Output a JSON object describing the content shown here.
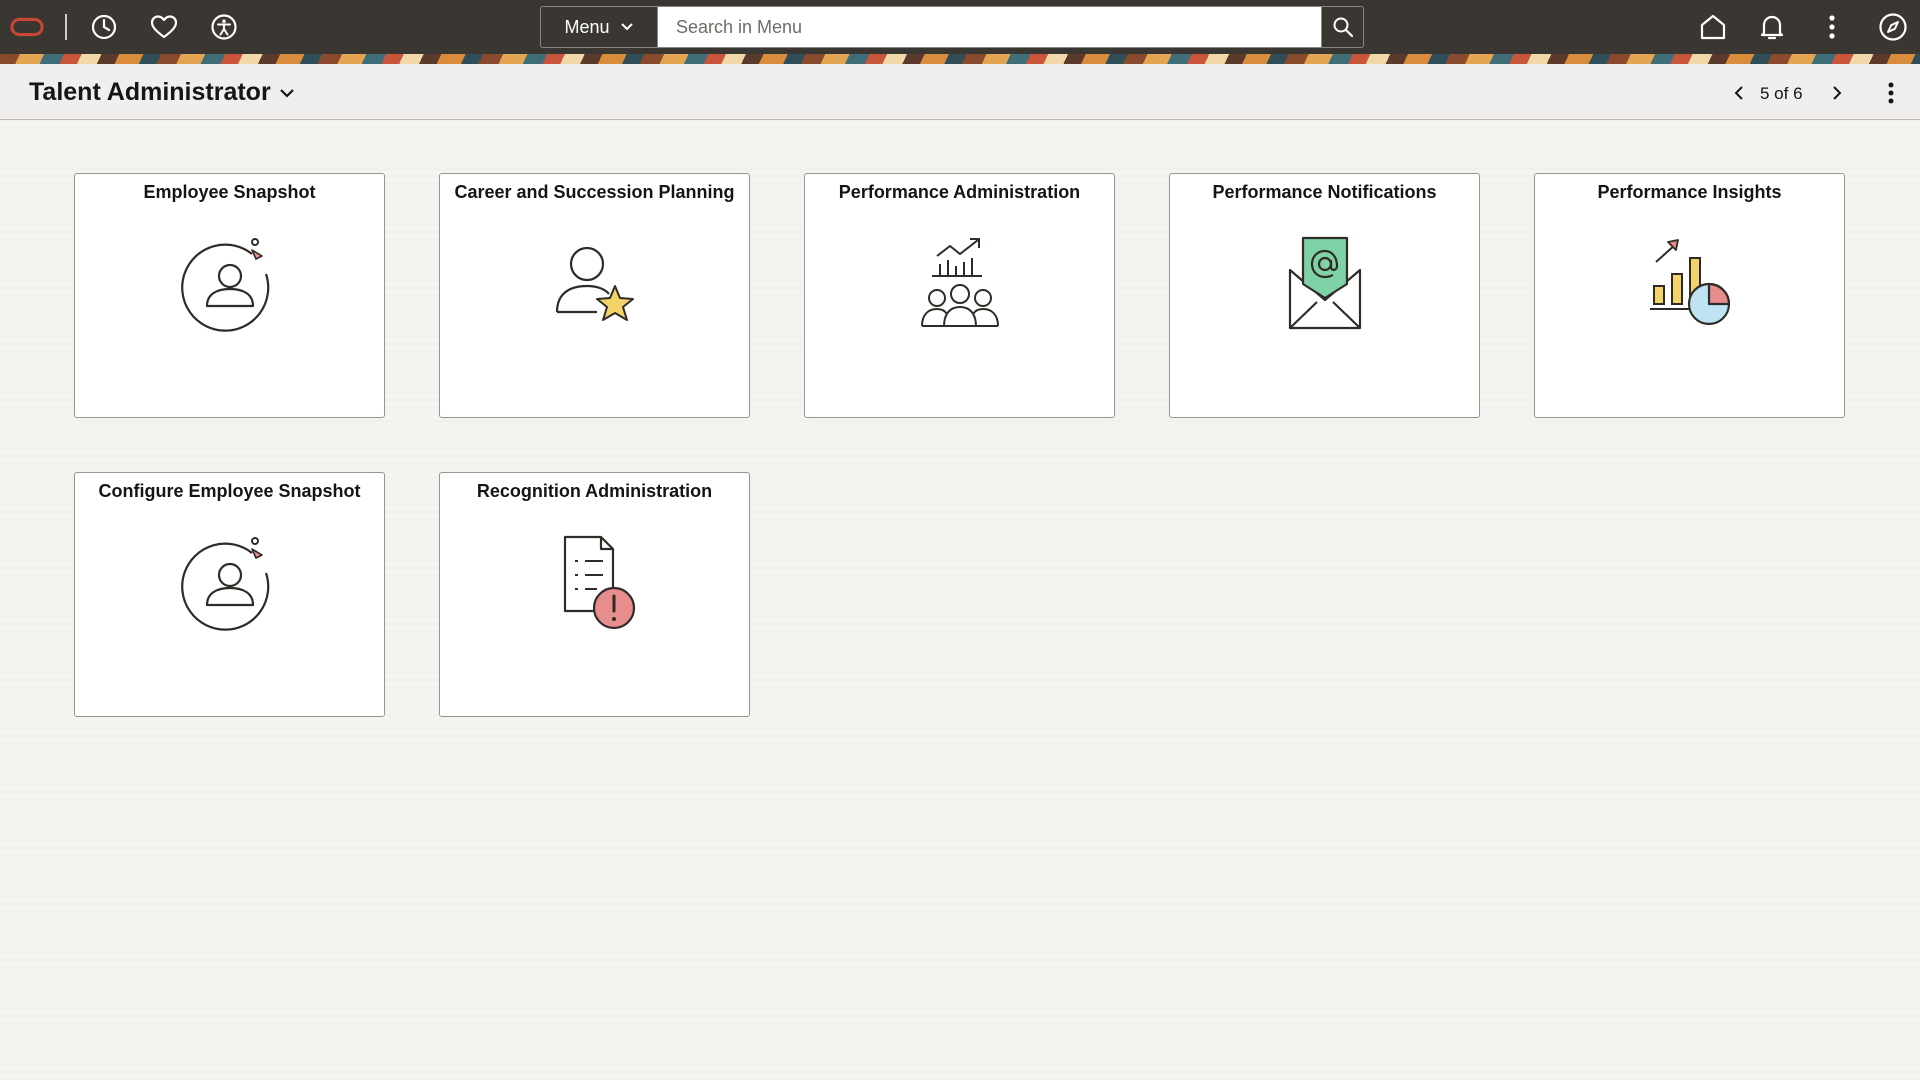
{
  "topbar": {
    "menu_label": "Menu",
    "search_placeholder": "Search in Menu"
  },
  "header": {
    "title": "Talent Administrator",
    "pagination": "5 of 6"
  },
  "tiles": [
    {
      "title": "Employee Snapshot",
      "icon": "employee-snapshot-icon"
    },
    {
      "title": "Career and Succession Planning",
      "icon": "person-star-icon"
    },
    {
      "title": "Performance Administration",
      "icon": "team-growth-chart-icon"
    },
    {
      "title": "Performance Notifications",
      "icon": "email-envelope-icon"
    },
    {
      "title": "Performance Insights",
      "icon": "analytics-charts-icon"
    },
    {
      "title": "Configure Employee Snapshot",
      "icon": "employee-snapshot-icon"
    },
    {
      "title": "Recognition Administration",
      "icon": "document-alert-icon"
    }
  ],
  "colors": {
    "topbar": "#3a3632",
    "oracle_logo": "#c74634",
    "accent_green": "#7fd1a6",
    "accent_yellow": "#f2d46b",
    "accent_pink": "#e88d8d",
    "accent_blue": "#bfe3f2"
  }
}
